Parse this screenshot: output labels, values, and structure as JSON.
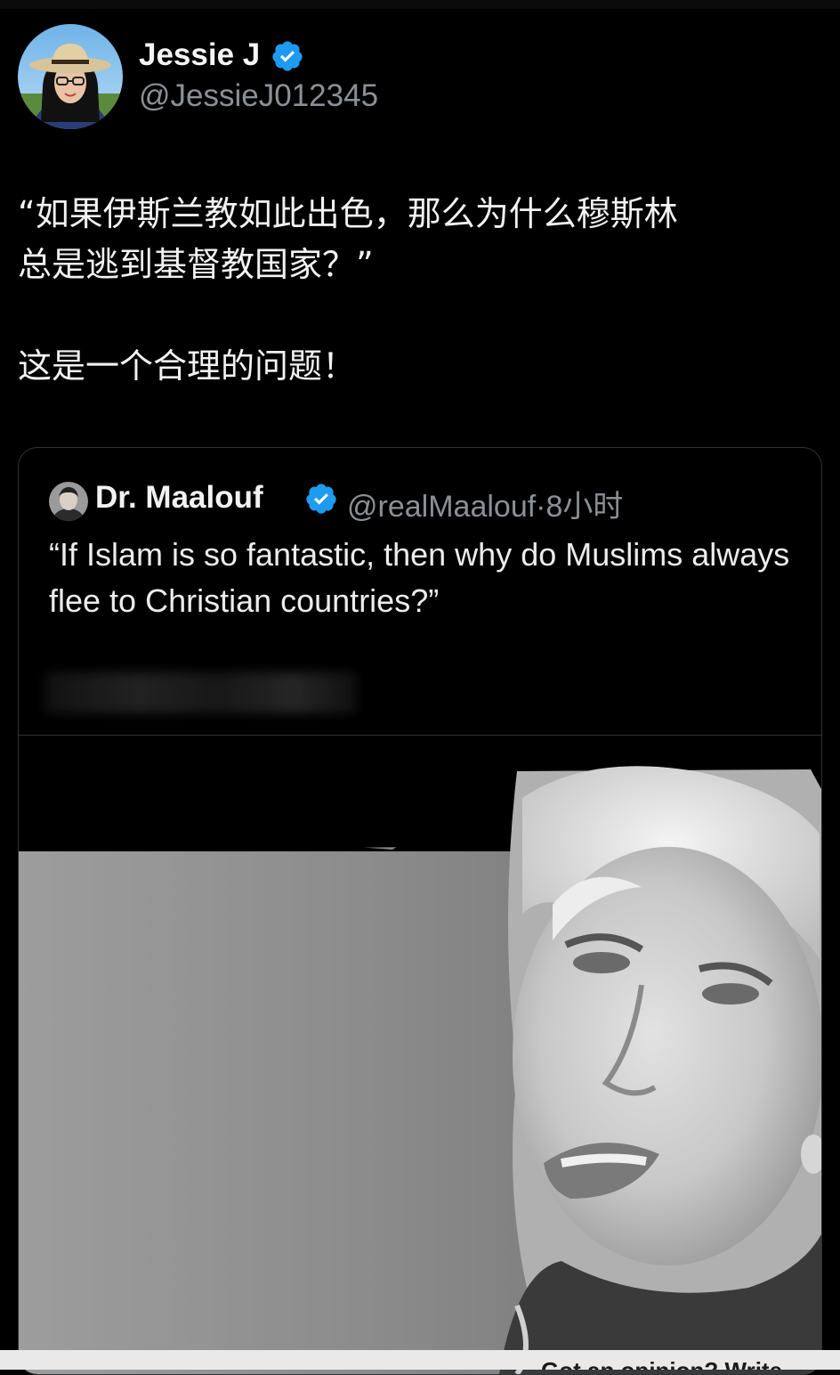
{
  "post": {
    "author_name": "Jessie J",
    "author_handle": "@JessieJ012345",
    "text_line1": "“如果伊斯兰教如此出色，那么为什么穆斯林",
    "text_line2": "总是逃到基督教国家？”",
    "text_line3": "这是一个合理的问题！"
  },
  "quoted_post": {
    "author_name": "Dr. Maalouf",
    "author_handle": "@realMaalouf",
    "separator": "·",
    "time": "8小时",
    "text": "“If Islam is so fantastic, then why do Muslims always flee to Christian countries?”"
  },
  "video": {
    "overlay_text": "Got an opinion? Write"
  },
  "colors": {
    "background": "#000000",
    "verified": "#1d9bf0",
    "handle": "#8b9096",
    "border": "#2f3336"
  },
  "icons": {
    "verified": "verified-badge-icon"
  }
}
